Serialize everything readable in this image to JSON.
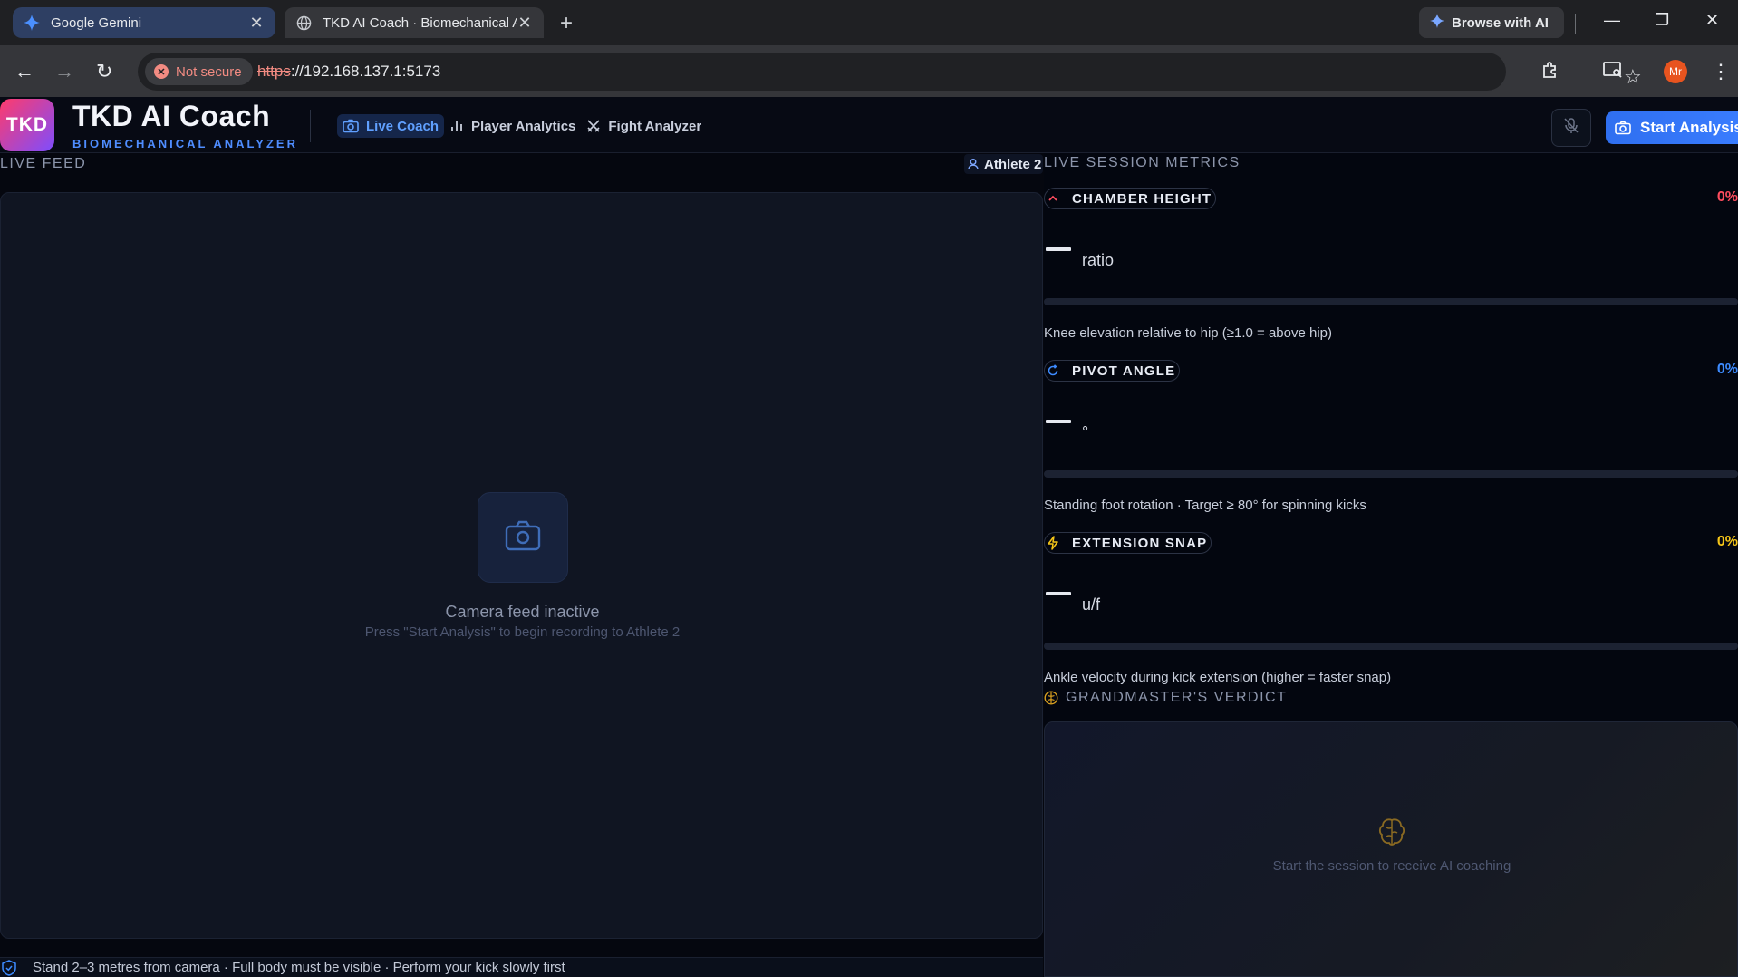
{
  "browser": {
    "tabs": [
      {
        "title": "Google Gemini",
        "active": false
      },
      {
        "title": "TKD AI Coach · Biomechanical A",
        "active": true
      }
    ],
    "browse_ai_label": "Browse with AI",
    "security_label": "Not secure",
    "url_scheme": "https",
    "url_rest": "://192.168.137.1:5173",
    "profile_initials": "Mr"
  },
  "app": {
    "logo_text": "TKD",
    "title": "TKD AI Coach",
    "subtitle": "BIOMECHANICAL ANALYZER",
    "nav": [
      {
        "label": "Live Coach",
        "active": true,
        "icon": "camera-icon"
      },
      {
        "label": "Player Analytics",
        "active": false,
        "icon": "bar-chart-icon"
      },
      {
        "label": "Fight Analyzer",
        "active": false,
        "icon": "crossed-swords-icon"
      }
    ],
    "start_button": "Start Analysis",
    "accent": "#3a7dff"
  },
  "feed": {
    "label": "LIVE FEED",
    "athlete": "Athlete 2",
    "inactive_title": "Camera feed inactive",
    "inactive_hint": "Press \"Start Analysis\" to begin recording to Athlete 2",
    "tip": "Stand 2–3 metres from camera · Full body must be visible · Perform your kick slowly first"
  },
  "metrics": {
    "label": "LIVE SESSION METRICS",
    "items": [
      {
        "name": "CHAMBER HEIGHT",
        "pct": "0%",
        "value": "—",
        "unit": "ratio",
        "progress": 0,
        "color": "#ff4d5e",
        "icon": "chevron-up-icon",
        "desc": "Knee elevation relative to hip (≥1.0 = above hip)"
      },
      {
        "name": "PIVOT ANGLE",
        "pct": "0%",
        "value": "—",
        "unit": "°",
        "progress": 0,
        "color": "#3d8bff",
        "icon": "rotate-icon",
        "desc": "Standing foot rotation · Target ≥ 80° for spinning kicks"
      },
      {
        "name": "EXTENSION SNAP",
        "pct": "0%",
        "value": "—",
        "unit": "u/f",
        "progress": 0,
        "color": "#f5c518",
        "icon": "lightning-icon",
        "desc": "Ankle velocity during kick extension (higher = faster snap)"
      }
    ]
  },
  "verdict": {
    "label": "GRANDMASTER'S VERDICT",
    "message": "Start the session to receive AI coaching"
  }
}
